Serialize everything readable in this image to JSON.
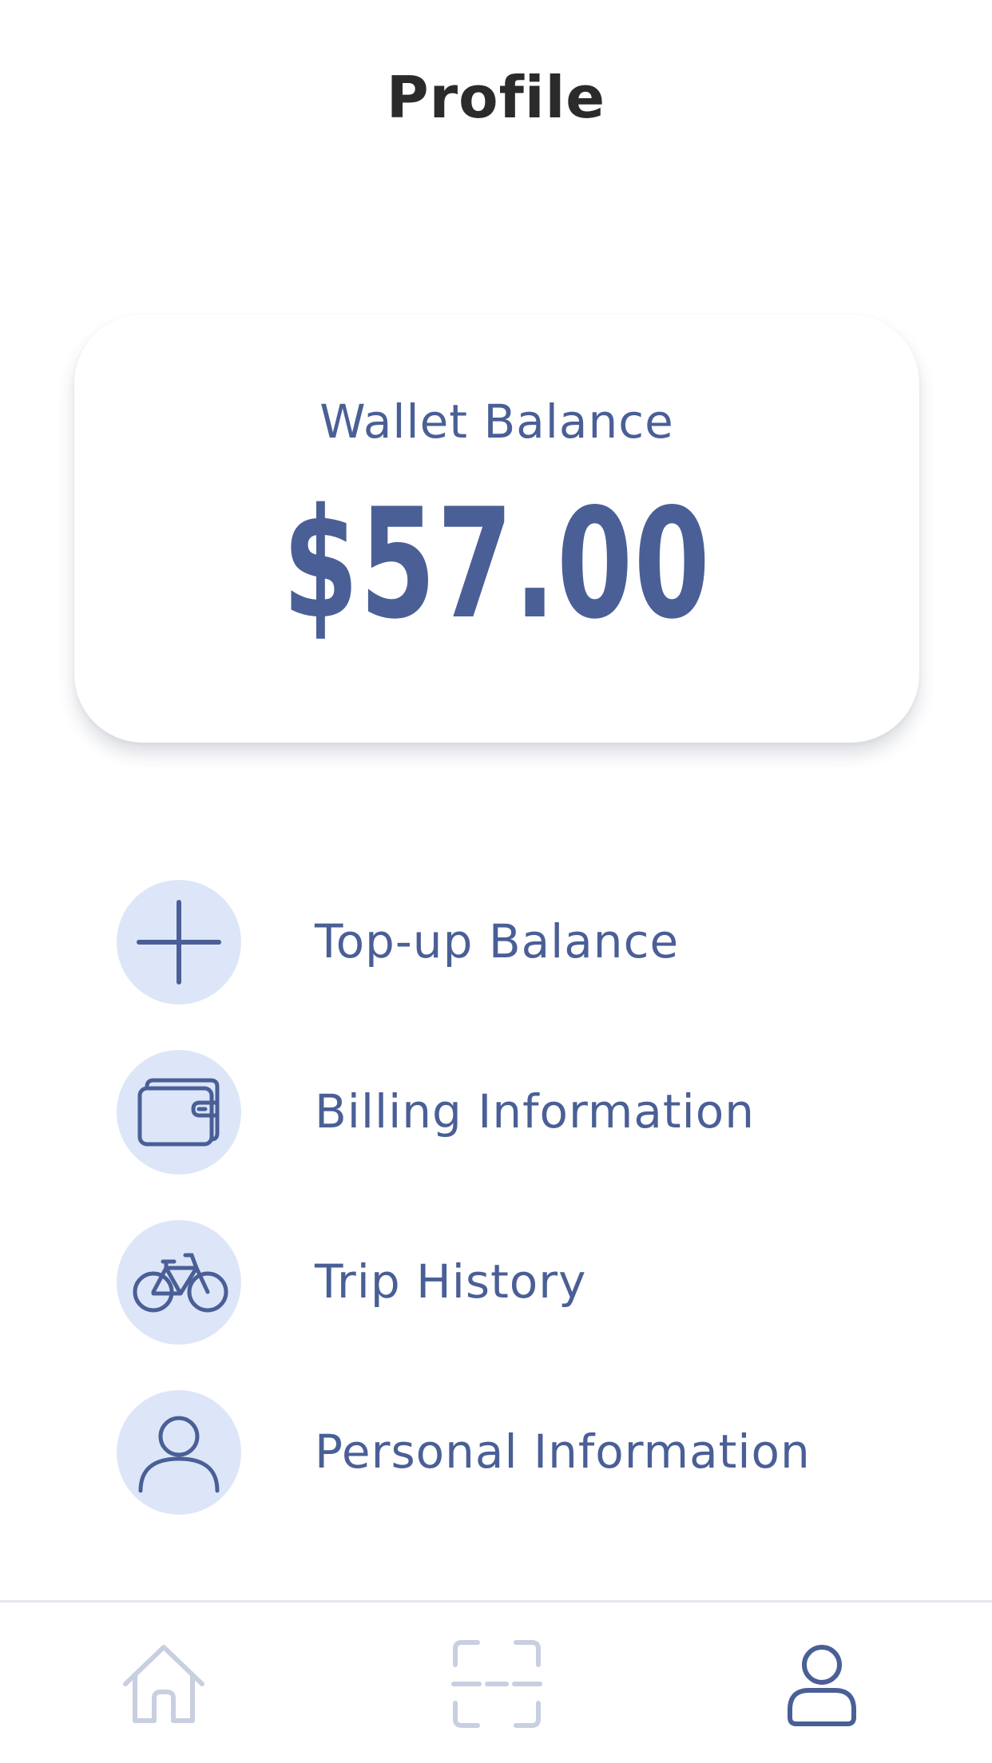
{
  "header": {
    "title": "Profile"
  },
  "wallet": {
    "label": "Wallet Balance",
    "amount": "$57.00"
  },
  "menu": {
    "items": [
      {
        "label": "Top-up Balance",
        "icon": "plus-icon"
      },
      {
        "label": "Billing Information",
        "icon": "wallet-icon"
      },
      {
        "label": "Trip History",
        "icon": "bicycle-icon"
      },
      {
        "label": "Personal Information",
        "icon": "person-icon"
      }
    ]
  },
  "tab_bar": {
    "tabs": [
      {
        "icon": "home-icon",
        "active": false
      },
      {
        "icon": "scan-icon",
        "active": false
      },
      {
        "icon": "profile-icon",
        "active": true
      }
    ]
  },
  "colors": {
    "accent": "#4a5f96",
    "icon_background": "#dde6f8",
    "inactive_tab": "#c8cfe0",
    "title": "#2b2b2b"
  }
}
